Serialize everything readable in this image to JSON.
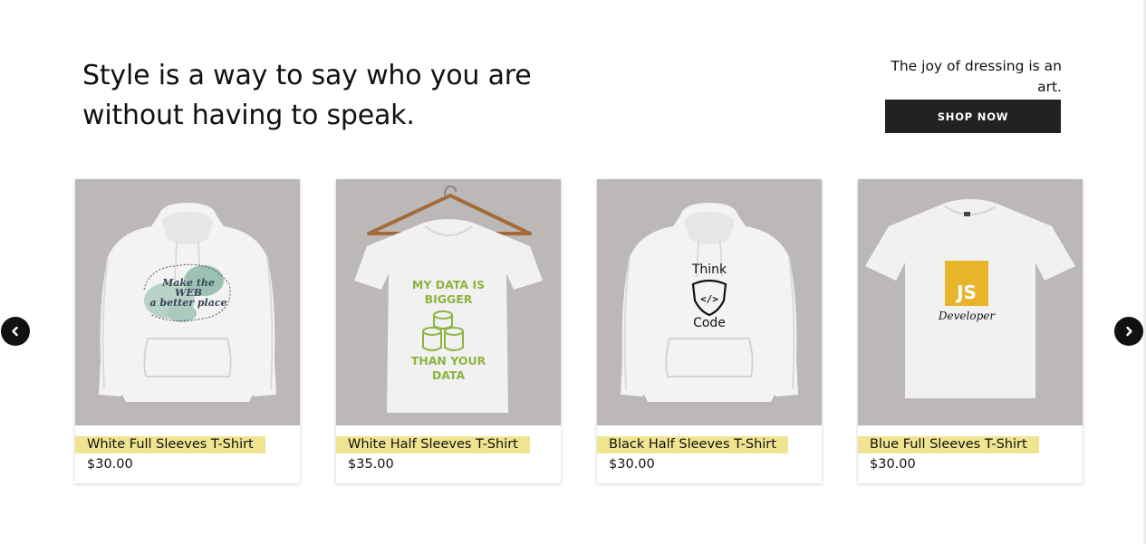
{
  "hero": {
    "headline": "Style is a way to say who you are without having to speak.",
    "tagline": "The joy of dressing is an art.",
    "shop_button_label": "SHOP NOW"
  },
  "carousel": {
    "prev_icon": "chevron-left-icon",
    "next_icon": "chevron-right-icon",
    "products": [
      {
        "name": "White Full Sleeves T-Shirt",
        "price": "$30.00",
        "garment": "hoodie",
        "print_text": [
          "Make the",
          "WEB",
          "a better place"
        ]
      },
      {
        "name": "White Half Sleeves T-Shirt",
        "price": "$35.00",
        "garment": "t-shirt-on-hanger",
        "print_text": [
          "MY DATA IS",
          "BIGGER",
          "THAN YOUR",
          "DATA"
        ]
      },
      {
        "name": "Black Half Sleeves T-Shirt",
        "price": "$30.00",
        "garment": "hoodie",
        "print_text": [
          "Think",
          "</>",
          "Code"
        ]
      },
      {
        "name": "Blue Full Sleeves T-Shirt",
        "price": "$30.00",
        "garment": "t-shirt",
        "print_text": [
          "JS",
          "Developer"
        ]
      }
    ]
  },
  "colors": {
    "image_background": "#bcb8b7",
    "title_highlight": "#efe48f",
    "button_background": "#222222",
    "data_print_green": "#8db43f",
    "js_badge_yellow": "#e8b42a"
  }
}
